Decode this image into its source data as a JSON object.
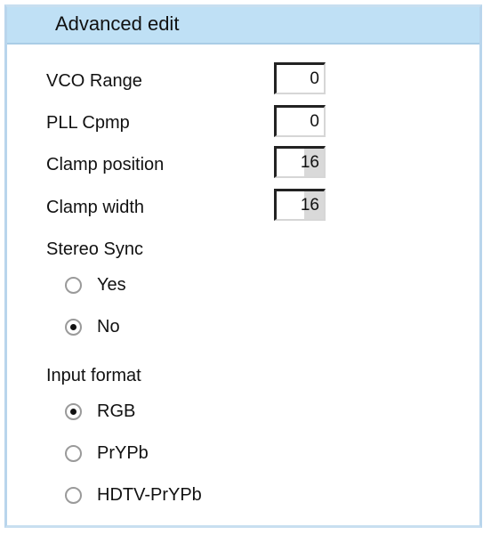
{
  "title": "Advanced edit",
  "fields": [
    {
      "label": "VCO Range",
      "value": "0"
    },
    {
      "label": "PLL Cpmp",
      "value": "0"
    },
    {
      "label": "Clamp position",
      "value": "16"
    },
    {
      "label": "Clamp width",
      "value": "16"
    }
  ],
  "stereo_sync": {
    "label": "Stereo Sync",
    "options": [
      {
        "label": "Yes",
        "selected": false
      },
      {
        "label": "No",
        "selected": true
      }
    ]
  },
  "input_format": {
    "label": "Input format",
    "options": [
      {
        "label": "RGB",
        "selected": true
      },
      {
        "label": "PrYPb",
        "selected": false
      },
      {
        "label": "HDTV-PrYPb",
        "selected": false
      }
    ]
  }
}
